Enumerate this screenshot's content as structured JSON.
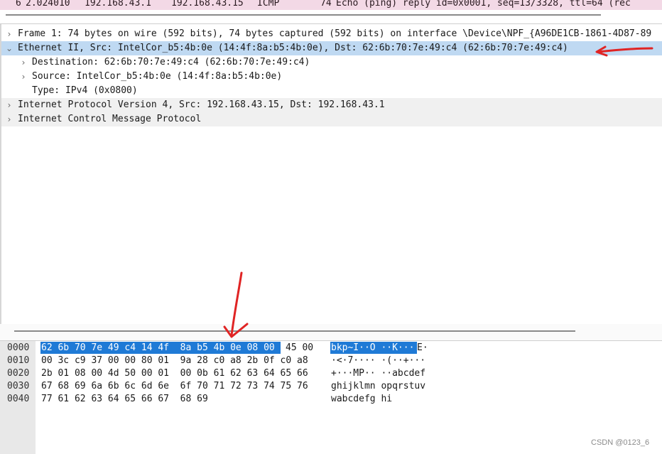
{
  "packet_list": {
    "row": {
      "no": "6",
      "time": "2.024010",
      "source": "192.168.43.1",
      "destination": "192.168.43.15",
      "protocol": "ICMP",
      "length": "74",
      "info": "Echo (ping) reply    id=0x0001, seq=13/3328, ttl=64 (rec"
    }
  },
  "details": {
    "frame": "Frame 1: 74 bytes on wire (592 bits), 74 bytes captured (592 bits) on interface \\Device\\NPF_{A96DE1CB-1861-4D87-89",
    "ethernet": "Ethernet II, Src: IntelCor_b5:4b:0e (14:4f:8a:b5:4b:0e), Dst: 62:6b:70:7e:49:c4 (62:6b:70:7e:49:c4)",
    "destination": "Destination: 62:6b:70:7e:49:c4 (62:6b:70:7e:49:c4)",
    "source": "Source: IntelCor_b5:4b:0e (14:4f:8a:b5:4b:0e)",
    "type": "Type: IPv4 (0x0800)",
    "ip": "Internet Protocol Version 4, Src: 192.168.43.15, Dst: 192.168.43.1",
    "icmp": "Internet Control Message Protocol"
  },
  "bytes": {
    "offsets": [
      "0000",
      "0010",
      "0020",
      "0030",
      "0040"
    ],
    "row0_hex_selected": "62 6b 70 7e 49 c4 14 4f  8a b5 4b 0e 08 00",
    "row0_hex_rest": "45 00",
    "row0_ascii_selected": "bkp~I··O ··K···",
    "row0_ascii_rest": "E·",
    "row1_hex": "00 3c c9 37 00 00 80 01  9a 28 c0 a8 2b 0f c0 a8",
    "row1_ascii": "·<·7···· ·(··+···",
    "row2_hex": "2b 01 08 00 4d 50 00 01  00 0b 61 62 63 64 65 66",
    "row2_ascii": "+···MP·· ··abcdef",
    "row3_hex": "67 68 69 6a 6b 6c 6d 6e  6f 70 71 72 73 74 75 76",
    "row3_ascii": "ghijklmn opqrstuv",
    "row4_hex": "77 61 62 63 64 65 66 67  68 69",
    "row4_ascii": "wabcdefg hi"
  },
  "watermark": "CSDN @0123_6",
  "colors": {
    "selection_row": "#bfd9f2",
    "byte_highlight": "#1f7ad6",
    "annotation_arrow": "#e02424",
    "packet_row_bg": "#f3d9e6"
  },
  "icons": {
    "collapsed": "chevron-right-icon",
    "expanded": "chevron-down-icon"
  }
}
